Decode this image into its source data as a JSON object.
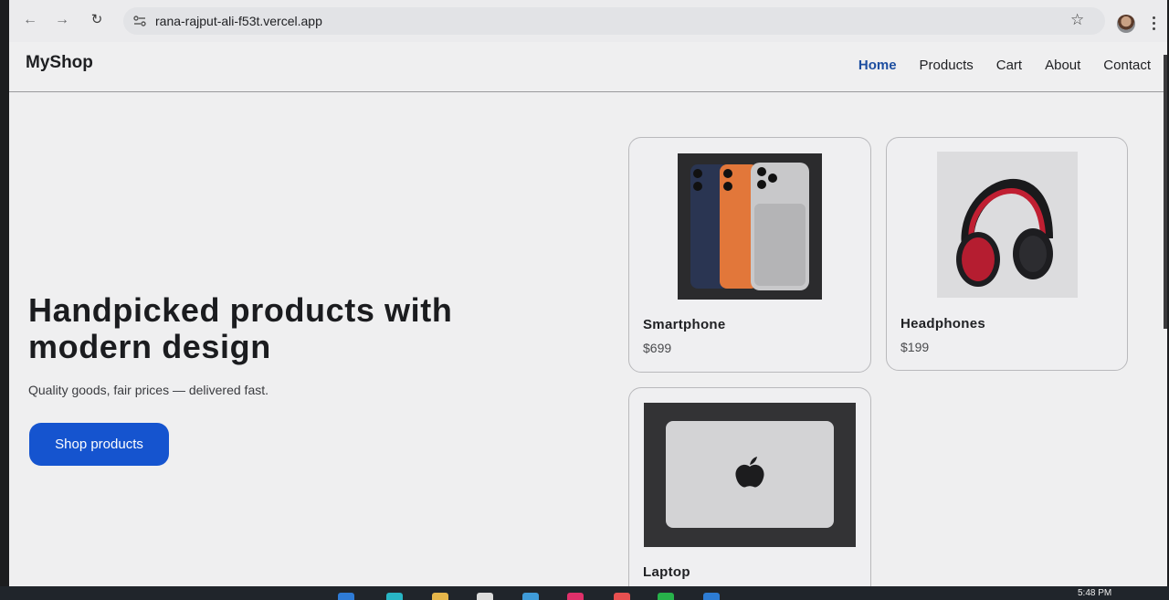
{
  "browser": {
    "url": "rana-rajput-ali-f53t.vercel.app",
    "icons": [
      "back-arrow-icon",
      "forward-arrow-icon",
      "reload-icon",
      "site-settings-icon",
      "bookmark-star-icon",
      "profile-avatar",
      "browser-menu-icon"
    ]
  },
  "site": {
    "logo": "MyShop",
    "nav": {
      "home": "Home",
      "products": "Products",
      "cart": "Cart",
      "about": "About",
      "contact": "Contact"
    },
    "accent": "#1554cf"
  },
  "hero": {
    "title": "Handpicked products with modern design",
    "subtitle": "Quality goods, fair prices — delivered fast.",
    "cta": "Shop products"
  },
  "products": [
    {
      "name": "Smartphone",
      "price": "$699",
      "image": "smartphone-image"
    },
    {
      "name": "Headphones",
      "price": "$199",
      "image": "headphones-image"
    },
    {
      "name": "Laptop",
      "price": "",
      "image": "laptop-image"
    }
  ],
  "taskbar": {
    "time": "5:48 PM"
  }
}
